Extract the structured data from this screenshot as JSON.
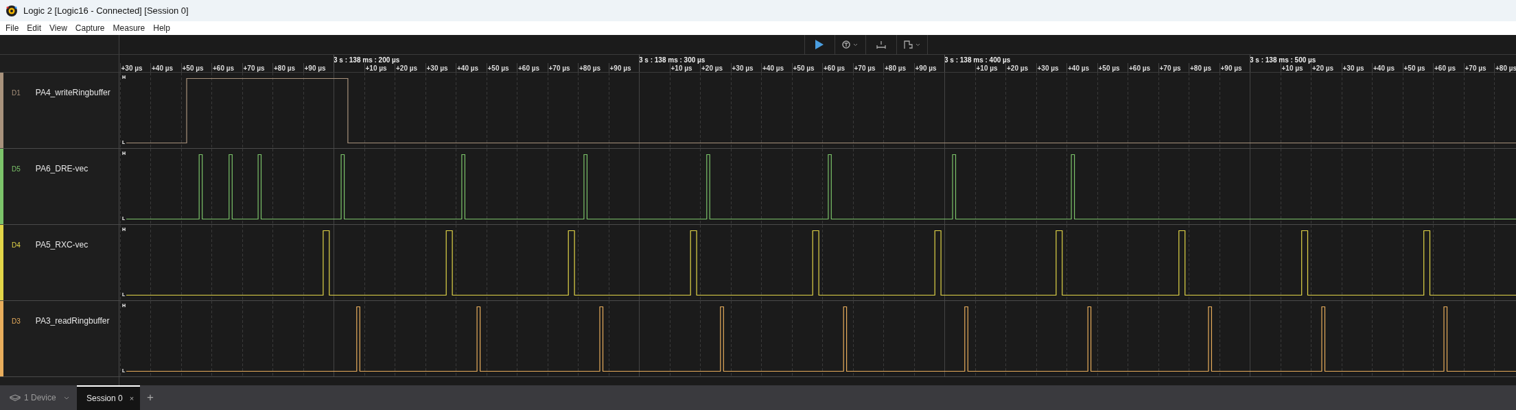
{
  "window": {
    "title": "Logic 2 [Logic16 - Connected] [Session 0]"
  },
  "menu": [
    "File",
    "Edit",
    "View",
    "Capture",
    "Measure",
    "Help"
  ],
  "ruler": {
    "lead_ticks": [
      "+30 µs",
      "+40 µs",
      "+50 µs",
      "+60 µs",
      "+70 µs",
      "+80 µs",
      "+90 µs"
    ],
    "segments": [
      {
        "label": "3 s : 138 ms : 200 µs",
        "ticks": [
          "+10 µs",
          "+20 µs",
          "+30 µs",
          "+40 µs",
          "+50 µs",
          "+60 µs",
          "+70 µs",
          "+80 µs",
          "+90 µs"
        ]
      },
      {
        "label": "3 s : 138 ms : 300 µs",
        "ticks": [
          "+10 µs",
          "+20 µs",
          "+30 µs",
          "+40 µs",
          "+50 µs",
          "+60 µs",
          "+70 µs",
          "+80 µs",
          "+90 µs"
        ]
      },
      {
        "label": "3 s : 138 ms : 400 µs",
        "ticks": [
          "+10 µs",
          "+20 µs",
          "+30 µs",
          "+40 µs",
          "+50 µs",
          "+60 µs",
          "+70 µs",
          "+80 µs",
          "+90 µs"
        ]
      },
      {
        "label": "3 s : 138 ms : 500 µs",
        "ticks": [
          "+10 µs",
          "+20 µs",
          "+30 µs",
          "+40 µs",
          "+50 µs",
          "+60 µs",
          "+70 µs",
          "+80 µs"
        ]
      }
    ]
  },
  "channels": [
    {
      "id": "D1",
      "name": "PA4_writeRingbuffer",
      "color": "#a8927c",
      "high_label": "H",
      "low_label": "L"
    },
    {
      "id": "D5",
      "name": "PA6_DRE-vec",
      "color": "#7cc46a",
      "high_label": "H",
      "low_label": "L"
    },
    {
      "id": "D4",
      "name": "PA5_RXC-vec",
      "color": "#e2d548",
      "high_label": "H",
      "low_label": "L"
    },
    {
      "id": "D3",
      "name": "PA3_readRingbuffer",
      "color": "#e8ad5c",
      "high_label": "H",
      "low_label": "L"
    }
  ],
  "bottom_bar": {
    "device": "1 Device",
    "tabs": [
      {
        "label": "Session 0",
        "close": "×",
        "selected": true
      }
    ],
    "add": "+"
  }
}
